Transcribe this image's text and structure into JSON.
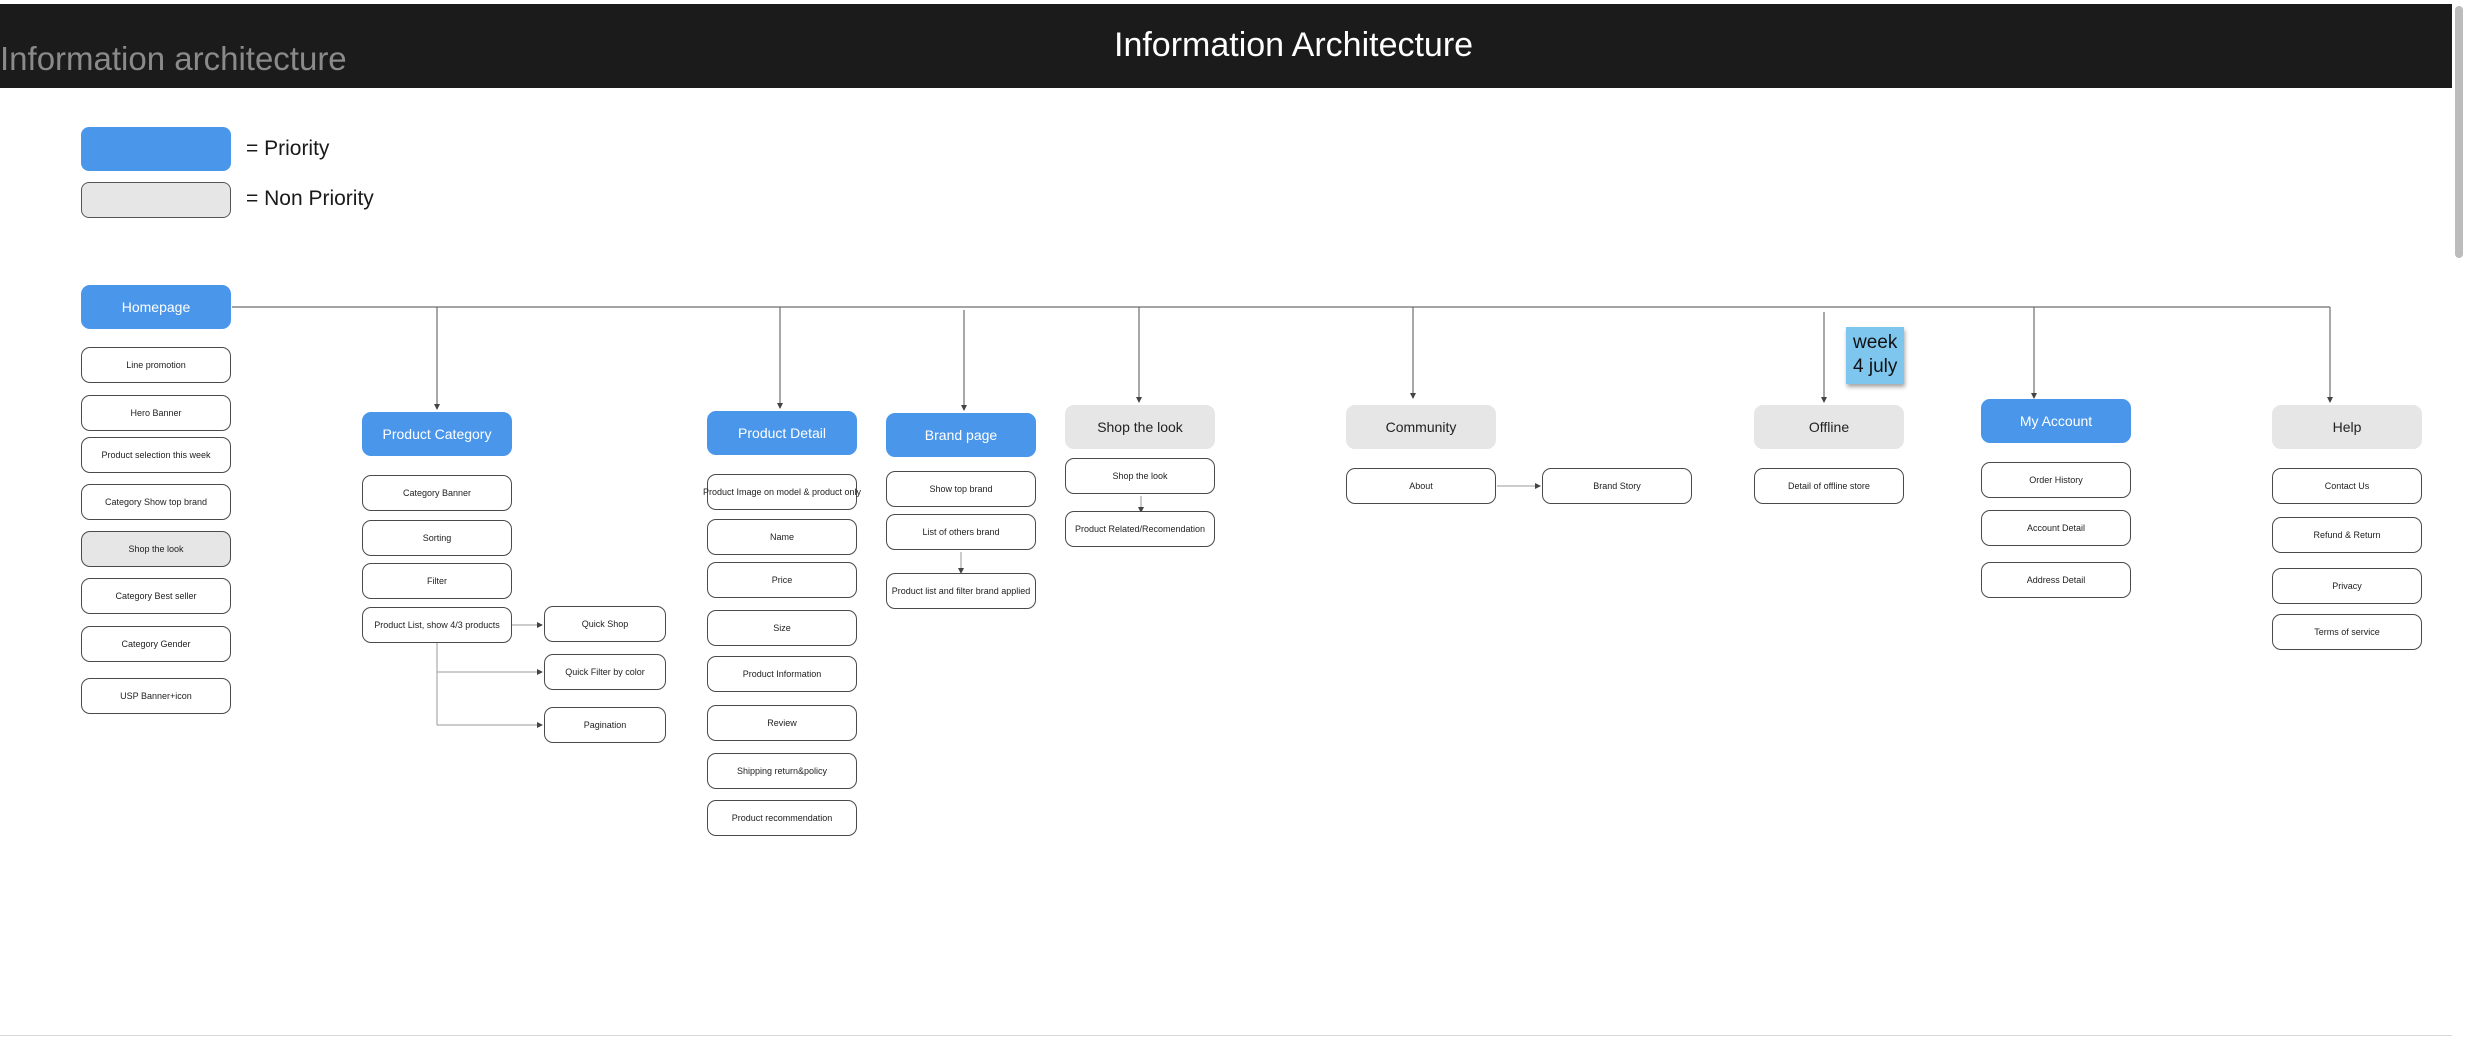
{
  "header": {
    "frame_title": "Information architecture",
    "board_title": "Information Architecture"
  },
  "legend": {
    "priority_label": "= Priority",
    "non_priority_label": "= Non Priority"
  },
  "colors": {
    "priority": "#4a96ea",
    "non_priority": "#e6e6e6",
    "header_bar": "#1b1b1b",
    "sticky_note": "#7ec6ee"
  },
  "sticky_note": {
    "line1": "week",
    "line2": "4 july"
  },
  "root": {
    "label": "Homepage"
  },
  "homepage_items": [
    {
      "label": "Line promotion"
    },
    {
      "label": "Hero Banner"
    },
    {
      "label": "Product selection this week"
    },
    {
      "label": "Category Show top brand"
    },
    {
      "label": "Shop the look",
      "highlighted": true
    },
    {
      "label": "Category Best seller"
    },
    {
      "label": "Category Gender"
    },
    {
      "label": "USP Banner+icon"
    }
  ],
  "sections": [
    {
      "id": "product-category",
      "label": "Product Category",
      "priority": true,
      "items": [
        {
          "label": "Category Banner"
        },
        {
          "label": "Sorting"
        },
        {
          "label": "Filter"
        },
        {
          "label": "Product List, show 4/3 products"
        }
      ],
      "sub_items": [
        {
          "label": "Quick Shop"
        },
        {
          "label": "Quick Filter by color"
        },
        {
          "label": "Pagination"
        }
      ]
    },
    {
      "id": "product-detail",
      "label": "Product Detail",
      "priority": true,
      "items": [
        {
          "label": "Product Image on model & product only"
        },
        {
          "label": "Name"
        },
        {
          "label": "Price"
        },
        {
          "label": "Size"
        },
        {
          "label": "Product Information"
        },
        {
          "label": "Review"
        },
        {
          "label": "Shipping return&policy"
        },
        {
          "label": "Product recommendation"
        }
      ]
    },
    {
      "id": "brand-page",
      "label": "Brand page",
      "priority": true,
      "items": [
        {
          "label": "Show top brand"
        },
        {
          "label": "List of others brand"
        },
        {
          "label": "Product list and filter brand applied"
        }
      ]
    },
    {
      "id": "shop-the-look",
      "label": "Shop the look",
      "priority": false,
      "items": [
        {
          "label": "Shop the look"
        },
        {
          "label": "Product Related/Recomendation"
        }
      ]
    },
    {
      "id": "community",
      "label": "Community",
      "priority": false,
      "items": [
        {
          "label": "About"
        },
        {
          "label": "Brand Story"
        }
      ]
    },
    {
      "id": "offline",
      "label": "Offline",
      "priority": false,
      "items": [
        {
          "label": "Detail of offline store"
        }
      ]
    },
    {
      "id": "my-account",
      "label": "My Account",
      "priority": true,
      "items": [
        {
          "label": "Order History"
        },
        {
          "label": "Account Detail"
        },
        {
          "label": "Address Detail"
        }
      ]
    },
    {
      "id": "help",
      "label": "Help",
      "priority": false,
      "items": [
        {
          "label": "Contact Us"
        },
        {
          "label": "Refund & Return"
        },
        {
          "label": "Privacy"
        },
        {
          "label": "Terms of service"
        }
      ]
    }
  ]
}
